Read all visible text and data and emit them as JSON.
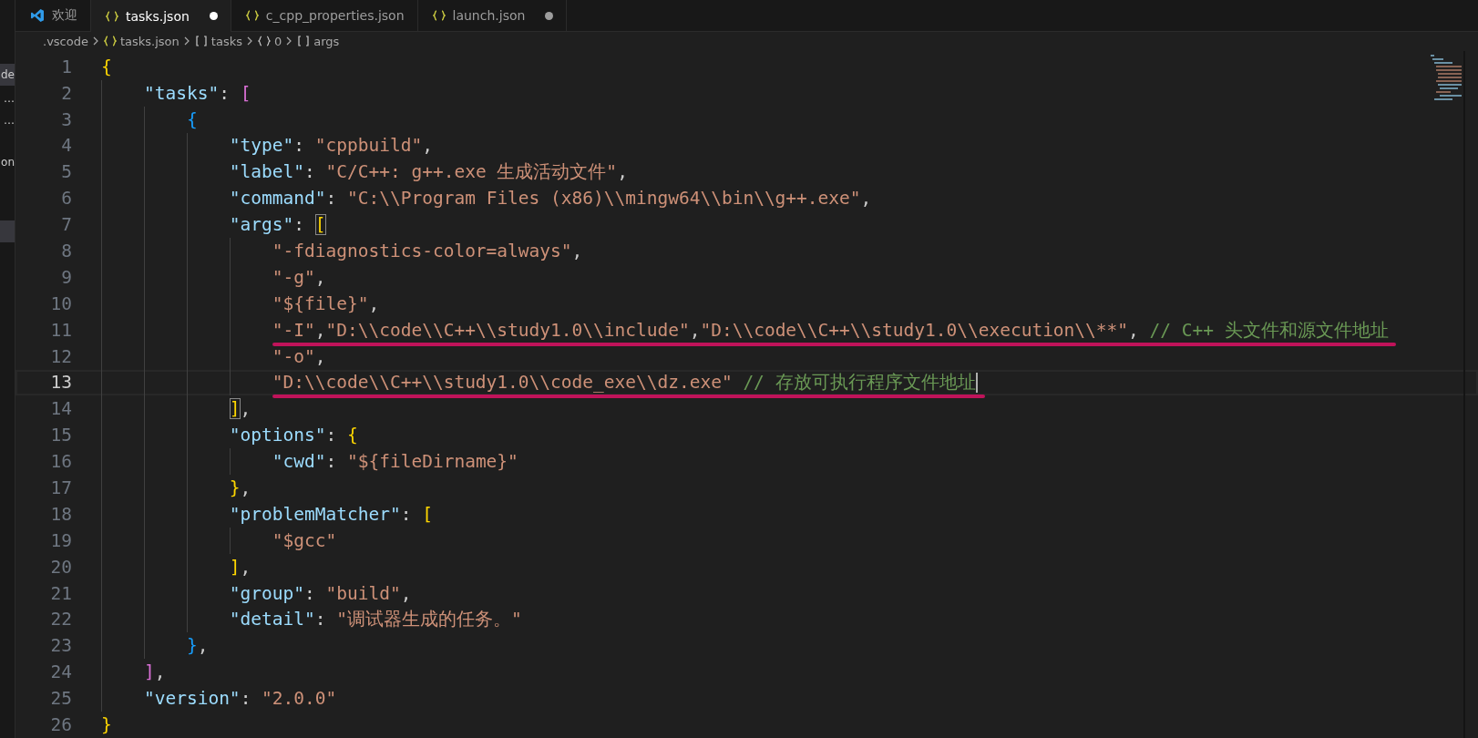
{
  "activity_bar": {
    "items": [
      {
        "label": "de",
        "selected": true
      },
      {
        "label": "…",
        "selected": false
      },
      {
        "label": "…",
        "selected": false
      },
      {
        "label": "on",
        "selected": false
      },
      {
        "selected": true
      }
    ]
  },
  "tabs": [
    {
      "label": "欢迎",
      "kind": "welcome",
      "selected": false,
      "modified": false
    },
    {
      "label": "tasks.json",
      "kind": "json",
      "selected": true,
      "modified": true
    },
    {
      "label": "c_cpp_properties.json",
      "kind": "json",
      "selected": false,
      "modified": false
    },
    {
      "label": "launch.json",
      "kind": "json",
      "selected": false,
      "modified": true
    }
  ],
  "breadcrumb": [
    {
      "label": ".vscode",
      "kind": "folder"
    },
    {
      "label": "tasks.json",
      "kind": "file"
    },
    {
      "label": "tasks",
      "kind": "array"
    },
    {
      "label": "0",
      "kind": "object"
    },
    {
      "label": "args",
      "kind": "array"
    }
  ],
  "editor": {
    "lines": [
      {
        "number": "1",
        "tokens": [
          {
            "kind": "bracket",
            "text": "{",
            "color": "#ffd700"
          }
        ],
        "children": [
          {
            "number": "2",
            "tokens": [
              {
                "kind": "key",
                "text": "\"tasks\""
              },
              {
                "kind": "punct",
                "text": ": "
              },
              {
                "kind": "bracket",
                "text": "[",
                "color": "#da70d6"
              }
            ],
            "children": [
              {
                "number": "3",
                "tokens": [
                  {
                    "kind": "bracket",
                    "text": "{",
                    "color": "#179fff"
                  }
                ],
                "children": [
                  {
                    "number": "4",
                    "tokens": [
                      {
                        "kind": "key",
                        "text": "\"type\""
                      },
                      {
                        "kind": "punct",
                        "text": ": "
                      },
                      {
                        "kind": "string",
                        "text": "\"cppbuild\""
                      },
                      {
                        "kind": "punct",
                        "text": ","
                      }
                    ]
                  },
                  {
                    "number": "5",
                    "tokens": [
                      {
                        "kind": "key",
                        "text": "\"label\""
                      },
                      {
                        "kind": "punct",
                        "text": ": "
                      },
                      {
                        "kind": "string",
                        "text": "\"C/C++: g++.exe 生成活动文件\""
                      },
                      {
                        "kind": "punct",
                        "text": ","
                      }
                    ]
                  },
                  {
                    "number": "6",
                    "tokens": [
                      {
                        "kind": "key",
                        "text": "\"command\""
                      },
                      {
                        "kind": "punct",
                        "text": ": "
                      },
                      {
                        "kind": "string",
                        "text": "\"C:\\\\Program Files (x86)\\\\mingw64\\\\bin\\\\g++.exe\""
                      },
                      {
                        "kind": "punct",
                        "text": ","
                      }
                    ]
                  },
                  {
                    "number": "7",
                    "tokens": [
                      {
                        "kind": "key",
                        "text": "\"args\""
                      },
                      {
                        "kind": "punct",
                        "text": ": "
                      },
                      {
                        "kind": "bracket",
                        "text": "[",
                        "color": "#ffd700",
                        "matched": true
                      }
                    ],
                    "children": [
                      {
                        "number": "8",
                        "tokens": [
                          {
                            "kind": "string",
                            "text": "\"-fdiagnostics-color=always\""
                          },
                          {
                            "kind": "punct",
                            "text": ","
                          }
                        ]
                      },
                      {
                        "number": "9",
                        "tokens": [
                          {
                            "kind": "string",
                            "text": "\"-g\""
                          },
                          {
                            "kind": "punct",
                            "text": ","
                          }
                        ]
                      },
                      {
                        "number": "10",
                        "tokens": [
                          {
                            "kind": "string",
                            "text": "\"${file}\""
                          },
                          {
                            "kind": "punct",
                            "text": ","
                          }
                        ]
                      },
                      {
                        "number": "11",
                        "underlined": true,
                        "tokens": [
                          {
                            "kind": "string",
                            "text": "\"-I\""
                          },
                          {
                            "kind": "punct",
                            "text": ","
                          },
                          {
                            "kind": "string",
                            "text": "\"D:\\\\code\\\\C++\\\\study1.0\\\\include\""
                          },
                          {
                            "kind": "punct",
                            "text": ","
                          },
                          {
                            "kind": "string",
                            "text": "\"D:\\\\code\\\\C++\\\\study1.0\\\\execution\\\\**\""
                          },
                          {
                            "kind": "punct",
                            "text": ","
                          },
                          {
                            "kind": "comment",
                            "text": "// C++ 头文件和源文件地址"
                          }
                        ]
                      },
                      {
                        "number": "12",
                        "tokens": [
                          {
                            "kind": "string",
                            "text": "\"-o\""
                          },
                          {
                            "kind": "punct",
                            "text": ","
                          }
                        ]
                      },
                      {
                        "number": "13",
                        "current": true,
                        "underlined": true,
                        "tokens": [
                          {
                            "kind": "string",
                            "text": "\"D:\\\\code\\\\C++\\\\study1.0\\\\code_exe\\\\dz.exe\""
                          },
                          {
                            "kind": "comment",
                            "text": "// 存放可执行程序文件地址"
                          }
                        ]
                      }
                    ]
                  },
                  {
                    "number": "14",
                    "tokens": [
                      {
                        "kind": "bracket",
                        "text": "]",
                        "color": "#ffd700",
                        "matched": true
                      },
                      {
                        "kind": "punct",
                        "text": ","
                      }
                    ]
                  },
                  {
                    "number": "15",
                    "tokens": [
                      {
                        "kind": "key",
                        "text": "\"options\""
                      },
                      {
                        "kind": "punct",
                        "text": ": "
                      },
                      {
                        "kind": "bracket",
                        "text": "{",
                        "color": "#ffd700"
                      }
                    ],
                    "children": [
                      {
                        "number": "16",
                        "tokens": [
                          {
                            "kind": "key",
                            "text": "\"cwd\""
                          },
                          {
                            "kind": "punct",
                            "text": ": "
                          },
                          {
                            "kind": "string",
                            "text": "\"${fileDirname}\""
                          }
                        ]
                      }
                    ]
                  },
                  {
                    "number": "17",
                    "tokens": [
                      {
                        "kind": "bracket",
                        "text": "}",
                        "color": "#ffd700"
                      },
                      {
                        "kind": "punct",
                        "text": ","
                      }
                    ]
                  },
                  {
                    "number": "18",
                    "tokens": [
                      {
                        "kind": "key",
                        "text": "\"problemMatcher\""
                      },
                      {
                        "kind": "punct",
                        "text": ": "
                      },
                      {
                        "kind": "bracket",
                        "text": "[",
                        "color": "#ffd700"
                      }
                    ],
                    "children": [
                      {
                        "number": "19",
                        "tokens": [
                          {
                            "kind": "string",
                            "text": "\"$gcc\""
                          }
                        ]
                      }
                    ]
                  },
                  {
                    "number": "20",
                    "tokens": [
                      {
                        "kind": "bracket",
                        "text": "]",
                        "color": "#ffd700"
                      },
                      {
                        "kind": "punct",
                        "text": ","
                      }
                    ]
                  },
                  {
                    "number": "21",
                    "tokens": [
                      {
                        "kind": "key",
                        "text": "\"group\""
                      },
                      {
                        "kind": "punct",
                        "text": ": "
                      },
                      {
                        "kind": "string",
                        "text": "\"build\""
                      },
                      {
                        "kind": "punct",
                        "text": ","
                      }
                    ]
                  },
                  {
                    "number": "22",
                    "tokens": [
                      {
                        "kind": "key",
                        "text": "\"detail\""
                      },
                      {
                        "kind": "punct",
                        "text": ": "
                      },
                      {
                        "kind": "string",
                        "text": "\"调试器生成的任务。\""
                      }
                    ]
                  }
                ]
              },
              {
                "number": "23",
                "tokens": [
                  {
                    "kind": "bracket",
                    "text": "}",
                    "color": "#179fff"
                  },
                  {
                    "kind": "punct",
                    "text": ","
                  }
                ]
              }
            ]
          },
          {
            "number": "24",
            "tokens": [
              {
                "kind": "bracket",
                "text": "]",
                "color": "#da70d6"
              },
              {
                "kind": "punct",
                "text": ","
              }
            ]
          },
          {
            "number": "25",
            "tokens": [
              {
                "kind": "key",
                "text": "\"version\""
              },
              {
                "kind": "punct",
                "text": ": "
              },
              {
                "kind": "string",
                "text": "\"2.0.0\""
              }
            ]
          }
        ]
      },
      {
        "number": "26",
        "tokens": [
          {
            "kind": "bracket",
            "text": "}",
            "color": "#ffd700"
          }
        ]
      }
    ]
  }
}
